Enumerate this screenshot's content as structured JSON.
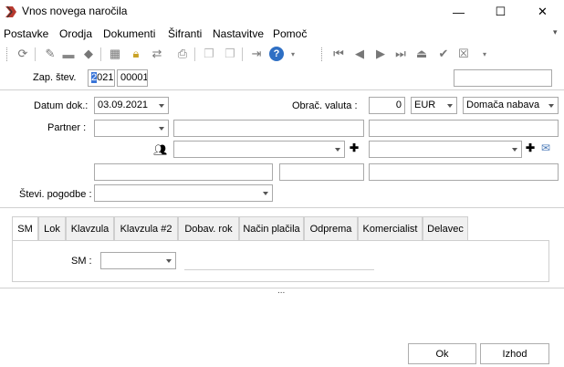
{
  "window": {
    "title": "Vnos novega naročila",
    "minimize": "—",
    "maximize": "☐",
    "close": "✕"
  },
  "menu": {
    "items": [
      "Postavke",
      "Orodja",
      "Dokumenti",
      "Šifranti",
      "Nastavitve",
      "Pomoč"
    ],
    "overflow": "▾"
  },
  "toolbar": {
    "icons": [
      "refresh-icon",
      "edit-icon",
      "open-folder-icon",
      "eraser-icon",
      "calculator-icon",
      "lock-icon",
      "transfer-icon",
      "print-icon",
      "copy-icon",
      "paste-icon",
      "exit-icon",
      "help-icon",
      "first-icon",
      "prev-icon",
      "next-icon",
      "last-icon",
      "eject-icon",
      "confirm-icon",
      "cancel-icon",
      "dropdown-icon"
    ]
  },
  "doc": {
    "zap_label": "Zap. štev.",
    "year": "2021",
    "number": "00001",
    "right_field": ""
  },
  "form": {
    "datum_label": "Datum dok.:",
    "datum_value": "03.09.2021",
    "obrac_label": "Obrač. valuta :",
    "rate_value": "0",
    "currency": "EUR",
    "nabava": "Domača nabava",
    "partner_label": "Partner :",
    "partner_value": "",
    "stev_label": "Števi. pogodbe :",
    "stev_value": ""
  },
  "tabs": [
    "SM",
    "Lok",
    "Klavzula",
    "Klavzula #2",
    "Dobav. rok",
    "Način plačila",
    "Odprema",
    "Komercialist",
    "Delavec"
  ],
  "tab_content": {
    "sm_label": "SM :",
    "sm_value": ""
  },
  "splitter": "...",
  "buttons": {
    "ok": "Ok",
    "izhod": "Izhod"
  }
}
